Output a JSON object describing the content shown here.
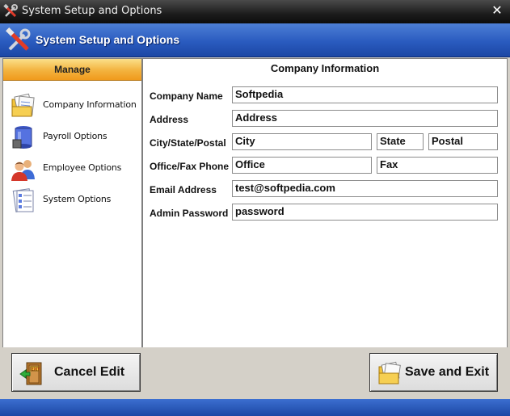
{
  "window": {
    "title": "System Setup and Options"
  },
  "header": {
    "title": "System Setup and Options"
  },
  "sidebar": {
    "heading": "Manage",
    "items": [
      {
        "label": "Company Information",
        "icon": "folder-documents-icon"
      },
      {
        "label": "Payroll Options",
        "icon": "payroll-jar-icon"
      },
      {
        "label": "Employee Options",
        "icon": "employees-icon"
      },
      {
        "label": "System Options",
        "icon": "checklist-icon"
      }
    ]
  },
  "company_form": {
    "title": "Company Information",
    "labels": {
      "company_name": "Company Name",
      "address": "Address",
      "city_state_postal": "City/State/Postal",
      "office_fax": "Office/Fax Phone",
      "email": "Email Address",
      "password": "Admin Password"
    },
    "values": {
      "company_name": "Softpedia",
      "address": "Address",
      "city": "City",
      "state": "State",
      "postal": "Postal",
      "office": "Office",
      "fax": "Fax",
      "email": "test@softpedia.com",
      "password": "password"
    }
  },
  "footer": {
    "cancel_label": "Cancel Edit",
    "save_label": "Save and Exit"
  },
  "colors": {
    "header_blue": "#2a5bbf",
    "manage_orange": "#f3b23e",
    "title_bar": "#1c1c1c"
  }
}
